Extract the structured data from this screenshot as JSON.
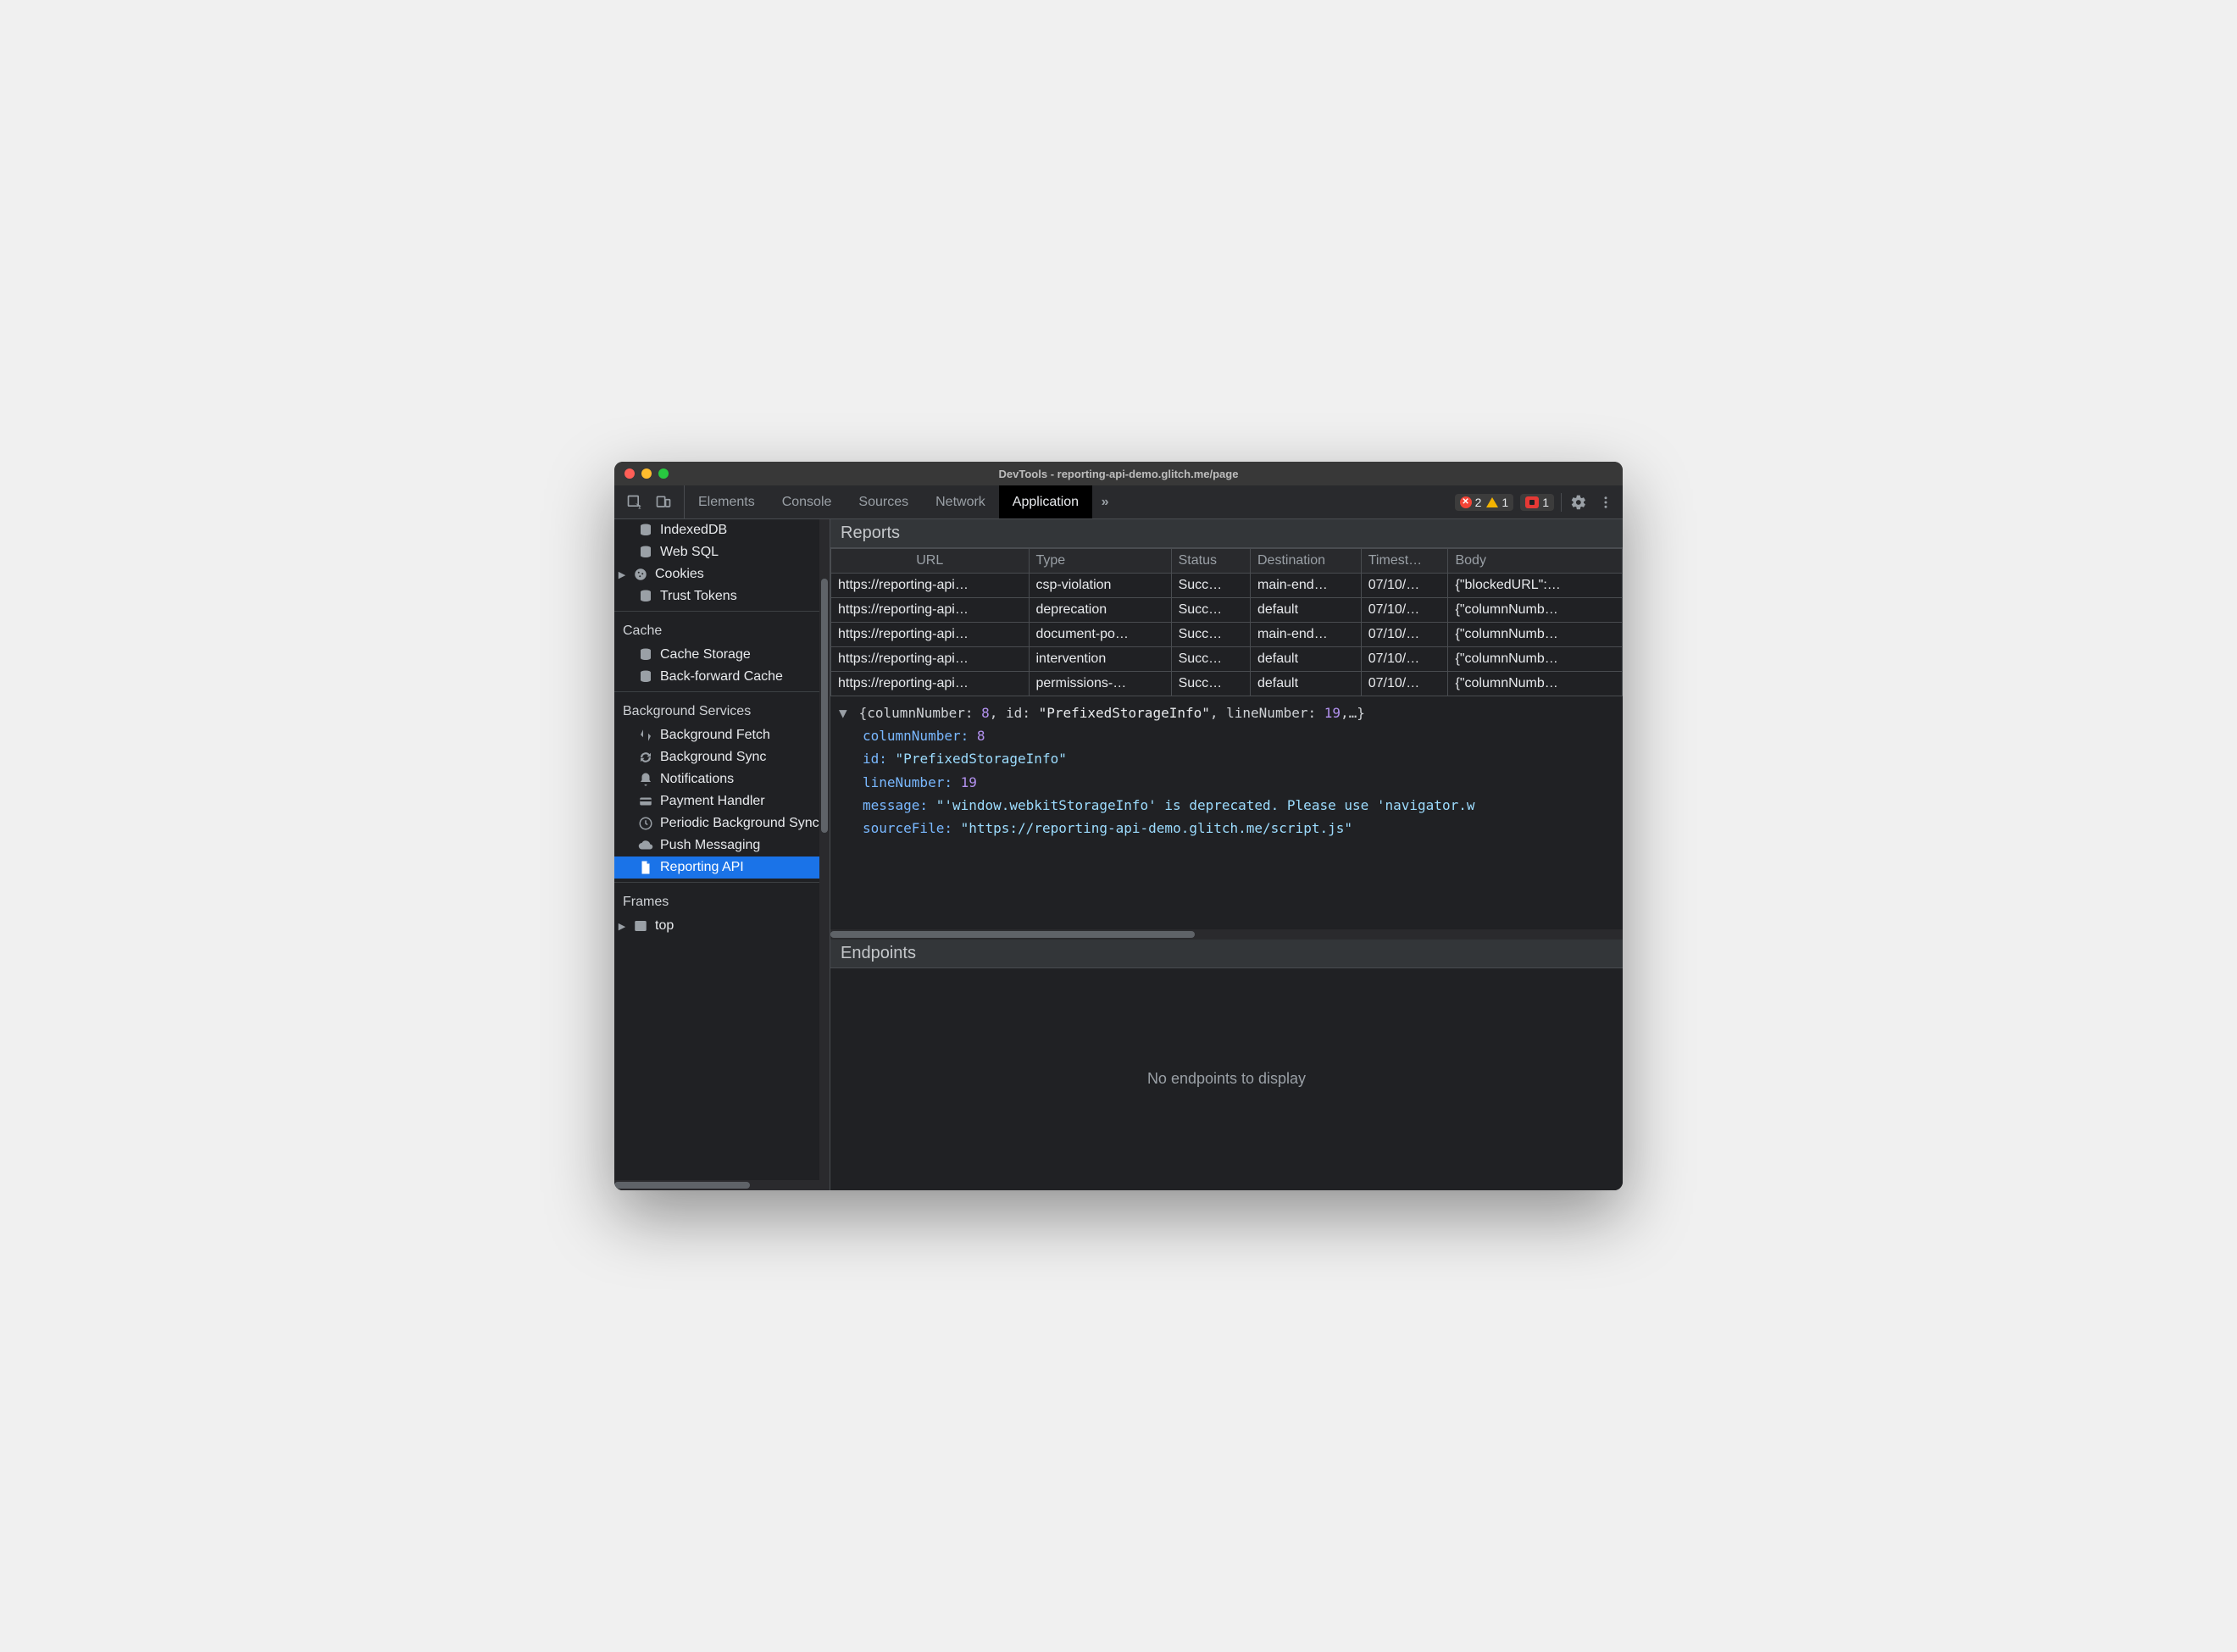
{
  "window_title": "DevTools - reporting-api-demo.glitch.me/page",
  "tabs": {
    "items": [
      "Elements",
      "Console",
      "Sources",
      "Network",
      "Application"
    ],
    "active_index": 4
  },
  "status": {
    "errors": "2",
    "warnings": "1",
    "issues": "1"
  },
  "sidebar": {
    "storage_items": [
      {
        "label": "IndexedDB",
        "icon": "database"
      },
      {
        "label": "Web SQL",
        "icon": "database"
      },
      {
        "label": "Cookies",
        "icon": "cookie",
        "expandable": true
      },
      {
        "label": "Trust Tokens",
        "icon": "database"
      }
    ],
    "cache_heading": "Cache",
    "cache_items": [
      {
        "label": "Cache Storage",
        "icon": "database"
      },
      {
        "label": "Back-forward Cache",
        "icon": "database"
      }
    ],
    "bg_heading": "Background Services",
    "bg_items": [
      {
        "label": "Background Fetch",
        "icon": "updown"
      },
      {
        "label": "Background Sync",
        "icon": "sync"
      },
      {
        "label": "Notifications",
        "icon": "bell"
      },
      {
        "label": "Payment Handler",
        "icon": "card"
      },
      {
        "label": "Periodic Background Sync",
        "icon": "clock"
      },
      {
        "label": "Push Messaging",
        "icon": "cloud"
      },
      {
        "label": "Reporting API",
        "icon": "file",
        "selected": true
      }
    ],
    "frames_heading": "Frames",
    "frames_items": [
      {
        "label": "top",
        "icon": "frame",
        "expandable": true
      }
    ]
  },
  "reports": {
    "title": "Reports",
    "columns": [
      "URL",
      "Type",
      "Status",
      "Destination",
      "Timest…",
      "Body"
    ],
    "rows": [
      {
        "url": "https://reporting-api…",
        "type": "csp-violation",
        "status": "Succ…",
        "dest": "main-end…",
        "ts": "07/10/…",
        "body": "{\"blockedURL\":…"
      },
      {
        "url": "https://reporting-api…",
        "type": "deprecation",
        "status": "Succ…",
        "dest": "default",
        "ts": "07/10/…",
        "body": "{\"columnNumb…"
      },
      {
        "url": "https://reporting-api…",
        "type": "document-po…",
        "status": "Succ…",
        "dest": "main-end…",
        "ts": "07/10/…",
        "body": "{\"columnNumb…"
      },
      {
        "url": "https://reporting-api…",
        "type": "intervention",
        "status": "Succ…",
        "dest": "default",
        "ts": "07/10/…",
        "body": "{\"columnNumb…"
      },
      {
        "url": "https://reporting-api…",
        "type": "permissions-…",
        "status": "Succ…",
        "dest": "default",
        "ts": "07/10/…",
        "body": "{\"columnNumb…"
      }
    ]
  },
  "preview": {
    "summary_pre": "{columnNumber: ",
    "summary_num1": "8",
    "summary_mid1": ", id: ",
    "summary_str1": "\"PrefixedStorageInfo\"",
    "summary_mid2": ", lineNumber: ",
    "summary_num2": "19",
    "summary_post": ",…}",
    "k1": "columnNumber:",
    "v1": "8",
    "k2": "id:",
    "v2": "\"PrefixedStorageInfo\"",
    "k3": "lineNumber:",
    "v3": "19",
    "k4": "message:",
    "v4": "\"'window.webkitStorageInfo' is deprecated. Please use 'navigator.w",
    "k5": "sourceFile:",
    "v5": "\"https://reporting-api-demo.glitch.me/script.js\""
  },
  "endpoints": {
    "title": "Endpoints",
    "empty": "No endpoints to display"
  }
}
